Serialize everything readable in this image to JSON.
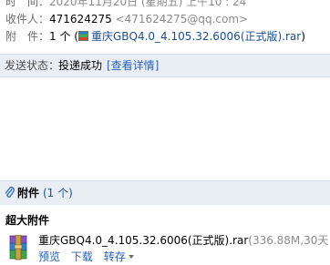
{
  "header": {
    "time_label": "时　间：",
    "time_value": "2020年11月20日 (星期五) 上午10 : 24",
    "recipient_label": "收件人：",
    "recipient_name": "471624275",
    "recipient_email": "<471624275@qq.com>",
    "attachment_label": "附　件：",
    "attachment_count": "1 个 (",
    "attachment_file": "重庆GBQ4.0_4.105.32.6006(正式版).rar",
    "attachment_close": ")"
  },
  "status": {
    "label": "发送状态：",
    "value": "投递成功",
    "detail_link": "[查看详情]"
  },
  "attachments": {
    "title": "附件",
    "count": "(1 个)",
    "section_title": "超大附件",
    "file_name": "重庆GBQ4.0_4.105.32.6006(正式版).rar",
    "file_meta": "(336.88M,30天",
    "actions": {
      "preview": "预览",
      "download": "下载",
      "forward": "转存"
    }
  },
  "icons": {
    "file_icon": "winrar-archive-icon",
    "clip_icon": "paperclip-icon"
  },
  "colors": {
    "link": "#2a61b5",
    "bar_bg": "#e9eef5"
  }
}
